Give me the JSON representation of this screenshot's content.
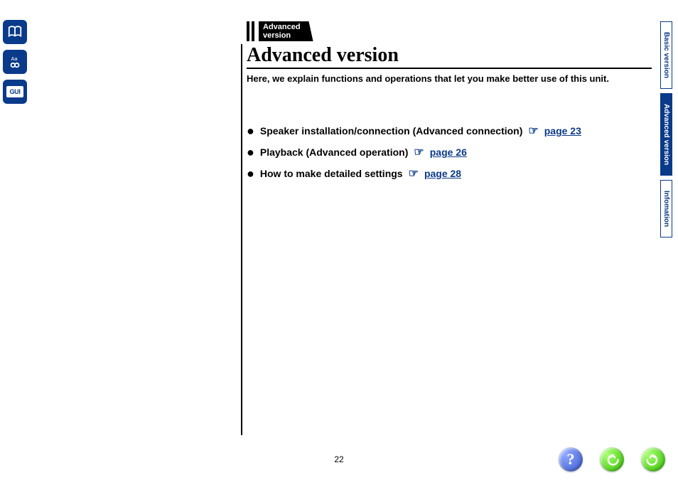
{
  "breadcrumb": {
    "line1": "Advanced",
    "line2": "version"
  },
  "title": "Advanced version",
  "subtitle": "Here, we explain functions and operations that let you make better use of this unit.",
  "toc": [
    {
      "text": "Speaker installation/connection (Advanced connection)",
      "link": "page 23"
    },
    {
      "text": "Playback (Advanced operation)",
      "link": "page 26"
    },
    {
      "text": "How to make detailed settings",
      "link": "page 28"
    }
  ],
  "rightTabs": {
    "basic": "Basic version",
    "advanced": "Advanced version",
    "info": "Infomation"
  },
  "pageNumber": "22",
  "leftSidebar": {
    "guiLabel": "GUI"
  }
}
